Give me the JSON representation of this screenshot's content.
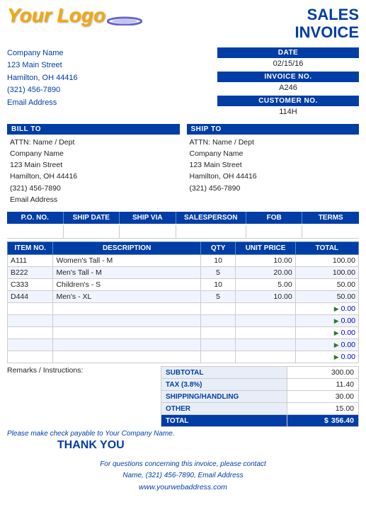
{
  "header": {
    "logo_text": "Your Logo",
    "title_line1": "SALES",
    "title_line2": "INVOICE"
  },
  "company": {
    "name": "Company Name",
    "address": "123 Main Street",
    "city_state_zip": "Hamilton, OH  44416",
    "phone": "(321) 456-7890",
    "email": "Email Address"
  },
  "invoice_meta": {
    "date_label": "DATE",
    "date_value": "02/15/16",
    "invoice_no_label": "INVOICE NO.",
    "invoice_no_value": "A246",
    "customer_no_label": "CUSTOMER NO.",
    "customer_no_value": "114H"
  },
  "bill_to": {
    "label": "BILL TO",
    "attn": "ATTN: Name / Dept",
    "company": "Company Name",
    "address": "123 Main Street",
    "city_state_zip": "Hamilton, OH  44416",
    "phone": "(321) 456-7890",
    "email": "Email Address"
  },
  "ship_to": {
    "label": "SHIP TO",
    "attn": "ATTN: Name / Dept",
    "company": "Company Name",
    "address": "123 Main Street",
    "city_state_zip": "Hamilton, OH  44416",
    "phone": "(321) 456-7890"
  },
  "order_header": {
    "columns": [
      "P.O. NO.",
      "SHIP DATE",
      "SHIP VIA",
      "SALESPERSON",
      "FOB",
      "TERMS"
    ]
  },
  "items_header": {
    "columns": [
      "ITEM NO.",
      "DESCRIPTION",
      "QTY",
      "UNIT PRICE",
      "TOTAL"
    ]
  },
  "items": [
    {
      "item_no": "A111",
      "description": "Women's Tall - M",
      "qty": "10",
      "unit_price": "10.00",
      "total": "100.00"
    },
    {
      "item_no": "B222",
      "description": "Men's Tall - M",
      "qty": "5",
      "unit_price": "20.00",
      "total": "100.00"
    },
    {
      "item_no": "C333",
      "description": "Children's - S",
      "qty": "10",
      "unit_price": "5.00",
      "total": "50.00"
    },
    {
      "item_no": "D444",
      "description": "Men's - XL",
      "qty": "5",
      "unit_price": "10.00",
      "total": "50.00"
    },
    {
      "item_no": "",
      "description": "",
      "qty": "",
      "unit_price": "",
      "total": "0.00"
    },
    {
      "item_no": "",
      "description": "",
      "qty": "",
      "unit_price": "",
      "total": "0.00"
    },
    {
      "item_no": "",
      "description": "",
      "qty": "",
      "unit_price": "",
      "total": "0.00"
    },
    {
      "item_no": "",
      "description": "",
      "qty": "",
      "unit_price": "",
      "total": "0.00"
    },
    {
      "item_no": "",
      "description": "",
      "qty": "",
      "unit_price": "",
      "total": "0.00"
    }
  ],
  "remarks": {
    "label": "Remarks / Instructions:"
  },
  "totals": [
    {
      "label": "SUBTOTAL",
      "value": "300.00"
    },
    {
      "label": "TAX (3.8%)",
      "value": "11.40"
    },
    {
      "label": "SHIPPING/HANDLING",
      "value": "30.00"
    },
    {
      "label": "OTHER",
      "value": "15.00"
    },
    {
      "label": "TOTAL",
      "symbol": "$",
      "value": "356.40"
    }
  ],
  "footer": {
    "check_payable": "Please make check payable to Your Company Name.",
    "thank_you": "THANK YOU",
    "contact_line1": "For questions concerning this invoice, please contact",
    "contact_line2": "Name, (321) 456-7890, Email Address",
    "website": "www.yourwebaddress.com"
  }
}
